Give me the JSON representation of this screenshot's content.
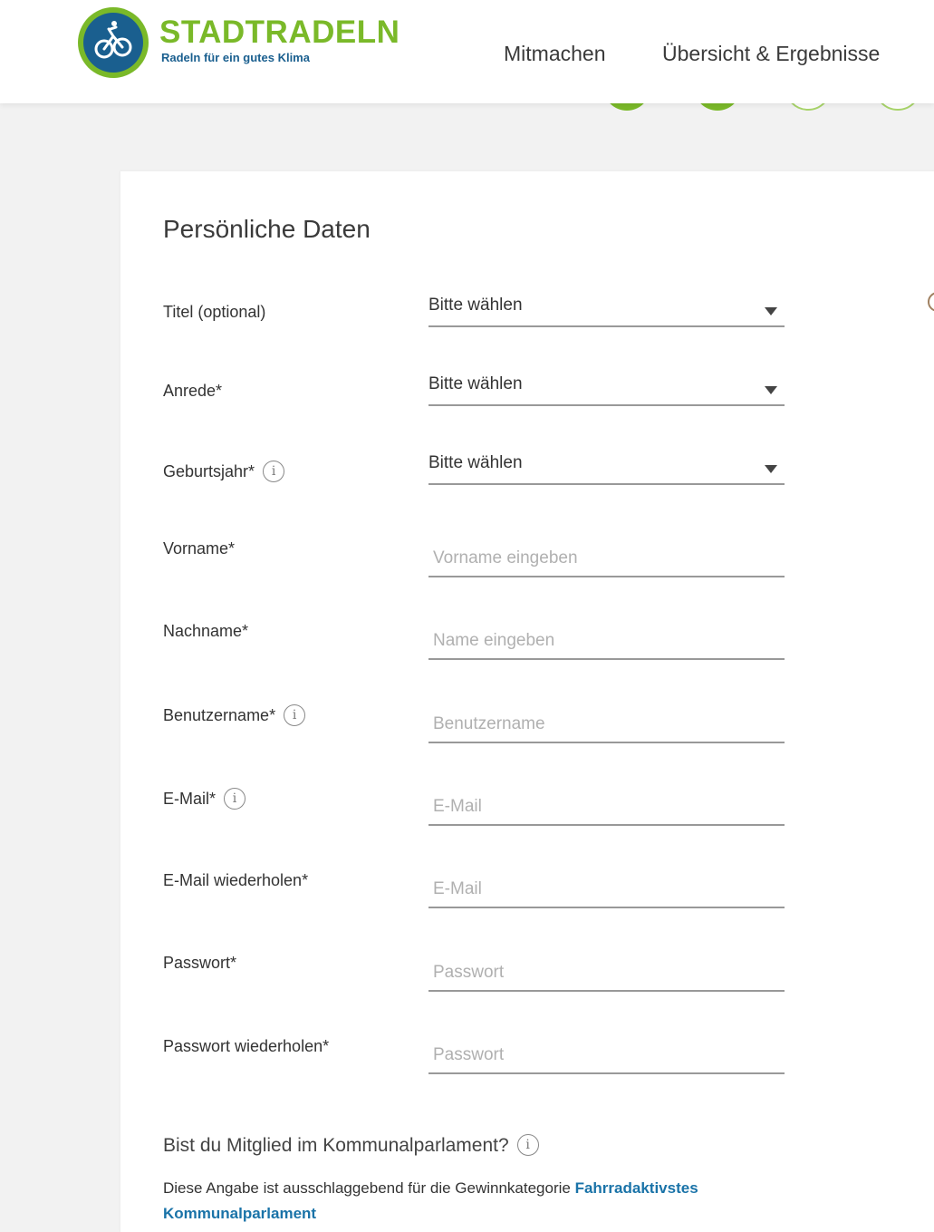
{
  "brand": {
    "name": "STADTRADELN",
    "tagline": "Radeln für ein gutes Klima"
  },
  "nav": {
    "items": [
      "Mitmachen",
      "Übersicht & Ergebnisse"
    ]
  },
  "form": {
    "title": "Persönliche Daten",
    "info_glyph": "i",
    "selects": [
      {
        "label": "Titel (optional)",
        "value": "Bitte wählen",
        "has_info": false
      },
      {
        "label": "Anrede*",
        "value": "Bitte wählen",
        "has_info": false
      },
      {
        "label": "Geburtsjahr*",
        "value": "Bitte wählen",
        "has_info": true
      }
    ],
    "inputs": [
      {
        "label": "Vorname*",
        "placeholder": "Vorname eingeben",
        "value": ""
      },
      {
        "label": "Nachname*",
        "placeholder": "Name eingeben",
        "value": ""
      },
      {
        "label": "Benutzername*",
        "placeholder": "Benutzername",
        "value": ""
      },
      {
        "label": "E-Mail*",
        "placeholder": "E-Mail",
        "value": ""
      },
      {
        "label": "E-Mail wiederholen*",
        "placeholder": "E-Mail",
        "value": ""
      },
      {
        "label": "Passwort*",
        "placeholder": "Passwort",
        "value": ""
      },
      {
        "label": "Passwort wiederholen*",
        "placeholder": "Passwort",
        "value": ""
      }
    ],
    "question": "Bist du Mitglied im Kommunalparlament?",
    "note_text": "Diese Angabe ist ausschlaggebend für die Gewinnkategorie ",
    "note_link": "Fahrradaktivstes Kommunalparlament"
  },
  "colors": {
    "brand_green": "#7ab929",
    "brand_blue": "#1a5f8f",
    "link_blue": "#1a73a8"
  },
  "icons": [
    "logo-bicycle-icon",
    "info-icon",
    "dropdown-arrow-icon"
  ]
}
